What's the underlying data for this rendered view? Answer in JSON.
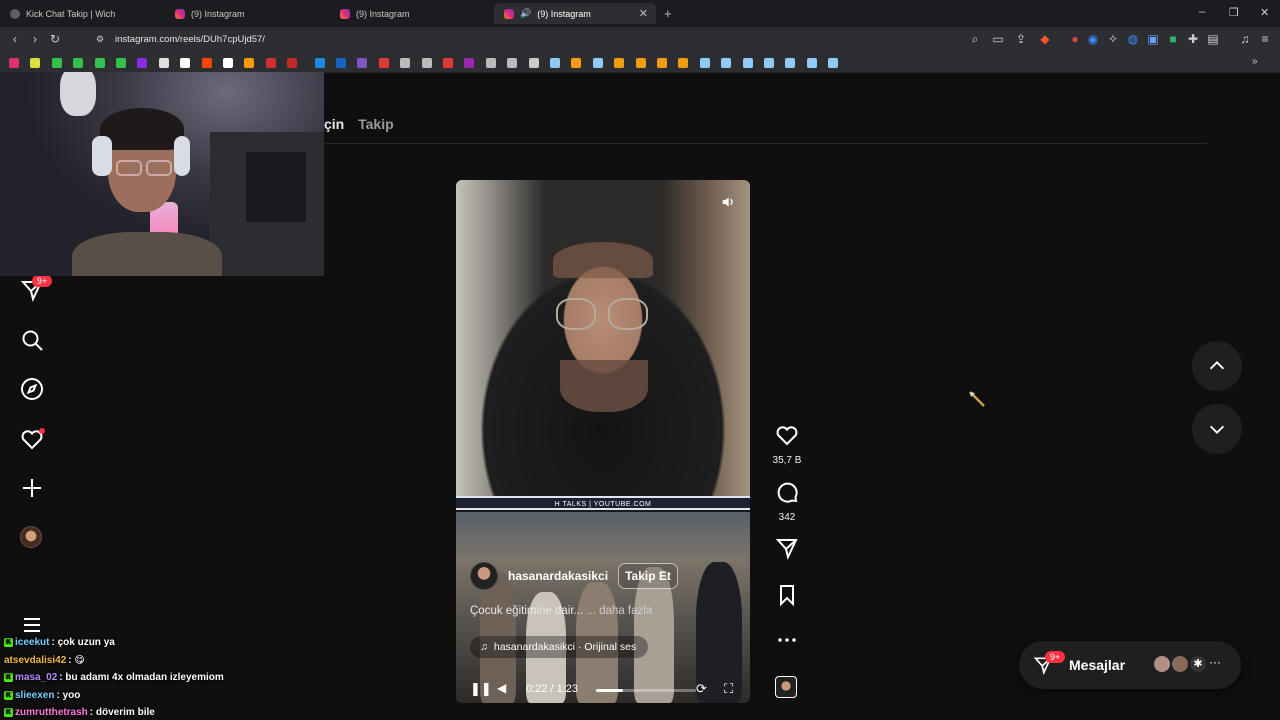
{
  "browser": {
    "tabs": [
      {
        "title": "Kick Chat Takip | Wich",
        "active": false
      },
      {
        "title": "(9) Instagram",
        "active": false
      },
      {
        "title": "(9) Instagram",
        "active": false
      },
      {
        "title": "(9) Instagram",
        "active": true
      }
    ],
    "url": "instagram.com/reels/DUh7cpUjd57/",
    "new_tab": "+",
    "window_controls": {
      "minimize": "–",
      "restore": "❐",
      "close": "✕"
    }
  },
  "instagram": {
    "feed_tabs": {
      "partial_for_you": "çin",
      "following": "Takip"
    },
    "sidebar_badge": "9+",
    "reel": {
      "watermark": "H TALKS | YOUTUBE.COM",
      "author": "hasanardakasikci",
      "follow_label": "Takip Et",
      "caption": "Çocuk eğitimine dair... ",
      "caption_more": "... daha fazla",
      "audio": "hasanardakasikci · Orijinal ses",
      "time": "0:22 / 1:23",
      "progress": 0.27
    },
    "actions": {
      "likes": "35,7 B",
      "comments": "342"
    },
    "messages": {
      "label": "Mesajlar",
      "badge": "9+"
    }
  },
  "chat": [
    {
      "user": "iceekut",
      "msg": ": çok uzun ya",
      "color": "#7ad0ff",
      "badge": "K"
    },
    {
      "user": "atsevdalisi42",
      "msg": ": 😋",
      "color": "#f5b945",
      "badge": ""
    },
    {
      "user": "masa_02",
      "msg": ": bu adamı 4x olmadan izleyemiom",
      "color": "#b889ff",
      "badge": "K"
    },
    {
      "user": "slieexen",
      "msg": ": yoo",
      "color": "#7ad0ff",
      "badge": "K"
    },
    {
      "user": "zumrutthetrash",
      "msg": ": döverim bile",
      "color": "#ff7ad6",
      "badge": "K"
    }
  ]
}
